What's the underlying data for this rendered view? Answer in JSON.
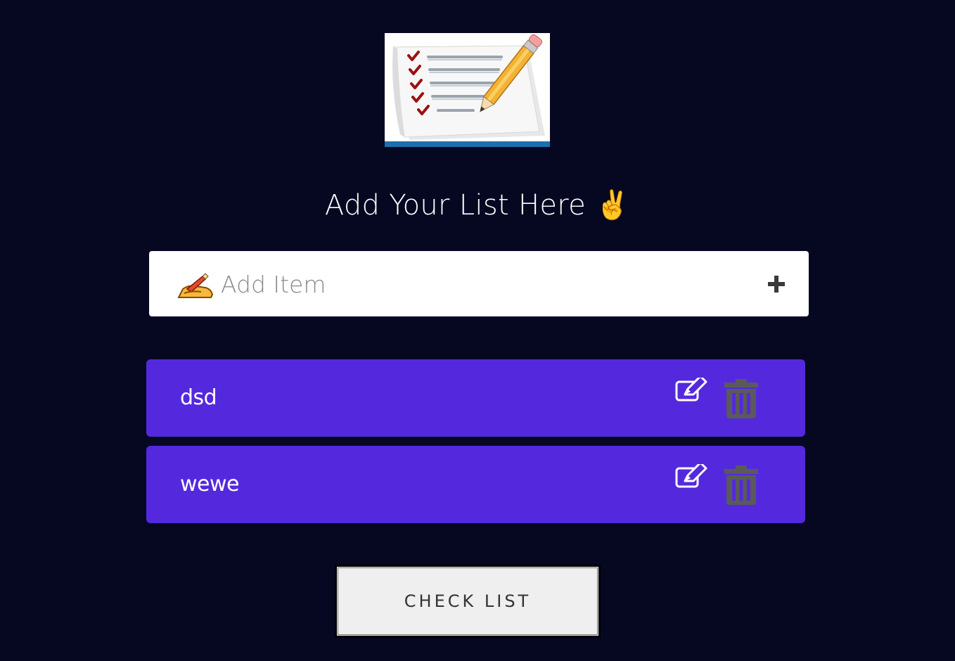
{
  "heading": {
    "title": "Add Your List Here ✌"
  },
  "input": {
    "placeholder": "Add Item",
    "value": "",
    "leading_icon": "writing-hand-emoji",
    "add_icon": "plus-icon"
  },
  "items": [
    {
      "text": "dsd"
    },
    {
      "text": "wewe"
    }
  ],
  "actions": {
    "edit_icon": "edit-icon",
    "delete_icon": "trash-icon"
  },
  "check_button": {
    "label": "CHECK LIST"
  },
  "colors": {
    "background": "#060822",
    "item_background": "#5429dd",
    "input_background": "#ffffff",
    "button_background": "#efefef",
    "trash_icon": "#5a5a5a"
  }
}
